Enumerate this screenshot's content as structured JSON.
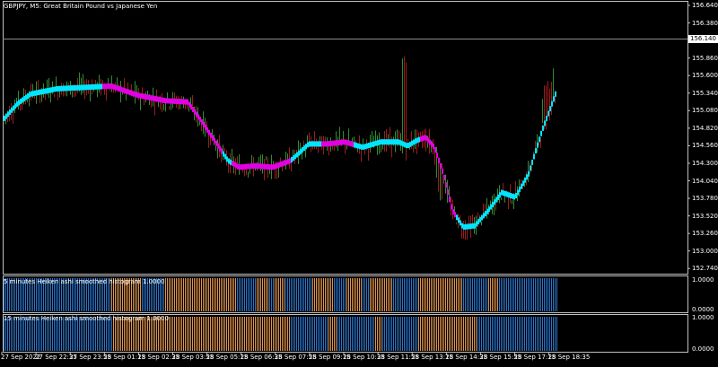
{
  "colors": {
    "background": "#000000",
    "frame": "#c0c0c0",
    "text": "#ffffff",
    "bull_candle": "#2f8f2f",
    "bear_candle": "#9b1c1c",
    "ha_up": "#00e5ff",
    "ha_down": "#e100e1",
    "hist_up": "#2c74c8",
    "hist_down": "#e0954f",
    "bid_line": "#8a8a8a"
  },
  "main_panel": {
    "title": "GBPJPY, M5:  Great Britain Pound vs Japanese Yen",
    "price_axis_labels": [
      "156.640",
      "156.380",
      "156.120",
      "155.860",
      "155.600",
      "155.340",
      "155.080",
      "154.820",
      "154.560",
      "154.300",
      "154.040",
      "153.780",
      "153.520",
      "153.260",
      "153.000",
      "152.740"
    ],
    "current_price_label": "156.140"
  },
  "indicator_1": {
    "title": "5 minutes Heiken ashi smoothed histogram 1.0000",
    "axis_labels": [
      "1.0000",
      "0.0000"
    ]
  },
  "indicator_2": {
    "title": "15 minutes Heiken ashi smoothed histogram 1.0000",
    "axis_labels": [
      "1.0000",
      "0.0000"
    ]
  },
  "time_axis_labels": [
    "27 Sep 2022",
    "27 Sep 22:35",
    "27 Sep 23:55",
    "28 Sep 01:15",
    "28 Sep 02:35",
    "28 Sep 03:55",
    "28 Sep 05:15",
    "28 Sep 06:35",
    "28 Sep 07:55",
    "28 Sep 09:15",
    "28 Sep 10:35",
    "28 Sep 11:55",
    "28 Sep 13:15",
    "28 Sep 14:35",
    "28 Sep 15:55",
    "28 Sep 17:15",
    "28 Sep 18:35"
  ],
  "chart_data": {
    "type": "line",
    "symbol": "GBPJPY",
    "timeframe": "M5",
    "y_range": [
      152.6,
      156.7
    ],
    "current_price": 156.14,
    "smoothed_path": {
      "x": [
        0,
        15,
        30,
        60,
        90,
        120,
        150,
        180,
        205,
        220,
        240,
        250,
        262,
        280,
        300,
        320,
        340,
        360,
        380,
        400,
        420,
        440,
        450,
        460,
        470,
        480,
        490,
        500,
        512,
        525,
        540,
        555,
        570,
        585,
        600,
        615
      ],
      "y": [
        154.92,
        155.15,
        155.3,
        155.38,
        155.4,
        155.42,
        155.28,
        155.2,
        155.18,
        154.9,
        154.5,
        154.3,
        154.2,
        154.22,
        154.2,
        154.3,
        154.55,
        154.55,
        154.58,
        154.5,
        154.58,
        154.58,
        154.52,
        154.6,
        154.65,
        154.5,
        154.1,
        153.55,
        153.3,
        153.32,
        153.55,
        153.82,
        153.75,
        154.1,
        154.75,
        155.3
      ]
    },
    "ha_trend_segments": [
      {
        "from": 0,
        "to": 110,
        "direction": "up"
      },
      {
        "from": 110,
        "to": 245,
        "direction": "down"
      },
      {
        "from": 245,
        "to": 255,
        "direction": "up"
      },
      {
        "from": 255,
        "to": 320,
        "direction": "down"
      },
      {
        "from": 320,
        "to": 355,
        "direction": "up"
      },
      {
        "from": 355,
        "to": 390,
        "direction": "down"
      },
      {
        "from": 390,
        "to": 465,
        "direction": "up"
      },
      {
        "from": 465,
        "to": 505,
        "direction": "down"
      },
      {
        "from": 505,
        "to": 615,
        "direction": "up"
      }
    ],
    "histogram_5m": [
      {
        "from": 0,
        "to": 120,
        "value": 1,
        "dir": "up"
      },
      {
        "from": 120,
        "to": 155,
        "value": 1,
        "dir": "down"
      },
      {
        "from": 155,
        "to": 180,
        "value": 1,
        "dir": "up"
      },
      {
        "from": 180,
        "to": 260,
        "value": 1,
        "dir": "down"
      },
      {
        "from": 260,
        "to": 282,
        "value": 1,
        "dir": "up"
      },
      {
        "from": 282,
        "to": 296,
        "value": 1,
        "dir": "down"
      },
      {
        "from": 296,
        "to": 302,
        "value": 1,
        "dir": "up"
      },
      {
        "from": 302,
        "to": 315,
        "value": 1,
        "dir": "down"
      },
      {
        "from": 315,
        "to": 345,
        "value": 1,
        "dir": "up"
      },
      {
        "from": 345,
        "to": 368,
        "value": 1,
        "dir": "down"
      },
      {
        "from": 368,
        "to": 382,
        "value": 1,
        "dir": "up"
      },
      {
        "from": 382,
        "to": 400,
        "value": 1,
        "dir": "down"
      },
      {
        "from": 400,
        "to": 408,
        "value": 1,
        "dir": "up"
      },
      {
        "from": 408,
        "to": 435,
        "value": 1,
        "dir": "down"
      },
      {
        "from": 435,
        "to": 462,
        "value": 1,
        "dir": "up"
      },
      {
        "from": 462,
        "to": 513,
        "value": 1,
        "dir": "down"
      },
      {
        "from": 513,
        "to": 540,
        "value": 1,
        "dir": "up"
      },
      {
        "from": 540,
        "to": 552,
        "value": 1,
        "dir": "down"
      },
      {
        "from": 552,
        "to": 618,
        "value": 1,
        "dir": "up"
      }
    ],
    "histogram_15m": [
      {
        "from": 0,
        "to": 122,
        "value": 1,
        "dir": "up"
      },
      {
        "from": 122,
        "to": 320,
        "value": 1,
        "dir": "down"
      },
      {
        "from": 320,
        "to": 362,
        "value": 1,
        "dir": "up"
      },
      {
        "from": 362,
        "to": 372,
        "value": 1,
        "dir": "down"
      },
      {
        "from": 372,
        "to": 415,
        "value": 1,
        "dir": "up"
      },
      {
        "from": 415,
        "to": 422,
        "value": 1,
        "dir": "down"
      },
      {
        "from": 422,
        "to": 462,
        "value": 1,
        "dir": "up"
      },
      {
        "from": 462,
        "to": 528,
        "value": 1,
        "dir": "down"
      },
      {
        "from": 528,
        "to": 618,
        "value": 1,
        "dir": "up"
      }
    ]
  }
}
